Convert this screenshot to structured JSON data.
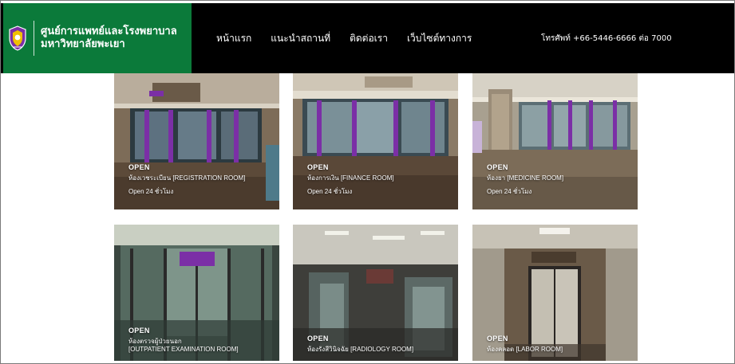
{
  "brand": {
    "line1": "ศูนย์การแพทย์และโรงพยาบาล",
    "line2": "มหาวิทยาลัยพะเยา",
    "logo_icon": "university-shield-icon",
    "color": "#0b7a3a"
  },
  "nav": {
    "items": [
      {
        "label": "หน้าแรก"
      },
      {
        "label": "แนะนำสถานที่"
      },
      {
        "label": "ติดต่อเรา"
      },
      {
        "label": "เว็บไซต์ทางการ"
      }
    ],
    "phone": "โทรศัพท์ +66-5446-6666 ต่อ 7000"
  },
  "rooms": [
    {
      "status": "OPEN",
      "name": "ห้องเวชระเบียน [REGISTRATION ROOM]",
      "hours": "Open 24 ชั่วโมง"
    },
    {
      "status": "OPEN",
      "name": "ห้องการเงิน [FINANCE ROOM]",
      "hours": "Open 24 ชั่วโมง"
    },
    {
      "status": "OPEN",
      "name": "ห้องยา [MEDICINE ROOM]",
      "hours": "Open 24 ชั่วโมง"
    },
    {
      "status": "OPEN",
      "name": "ห้องตรวจผู้ป่วยนอก\n[OUTPATIENT EXAMINATION ROOM]",
      "hours": ""
    },
    {
      "status": "OPEN",
      "name": "ห้องรังสีวินิจฉัย [RADIOLOGY ROOM]",
      "hours": ""
    },
    {
      "status": "OPEN",
      "name": "ห้องคลอด [LABOR ROOM]",
      "hours": ""
    }
  ],
  "colors": {
    "header_bg": "#000000",
    "accent_purple": "#7b2fa6"
  }
}
